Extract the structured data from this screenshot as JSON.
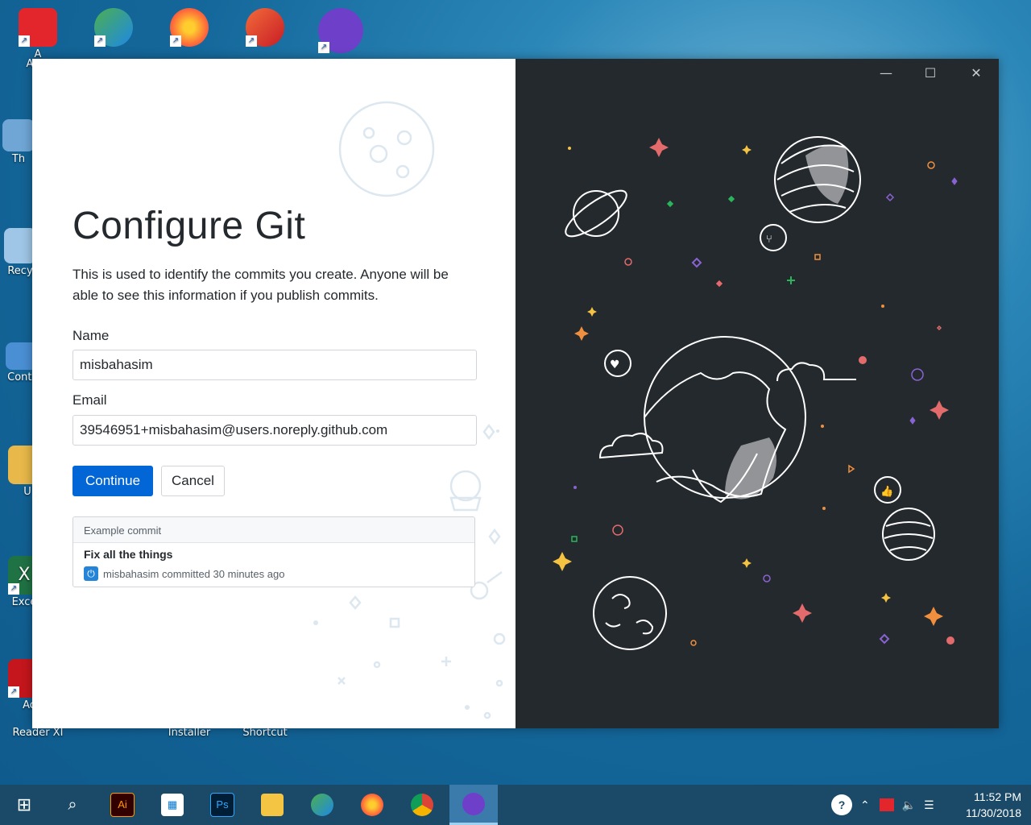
{
  "desktop": {
    "icons": [
      {
        "label": "A",
        "color": "#e3262c",
        "glyph": "A"
      },
      {
        "label": "",
        "color": "#2b8a3e",
        "glyph": "↓"
      },
      {
        "label": "",
        "color": "#ff7139",
        "glyph": "◉"
      },
      {
        "label": "",
        "color": "#d9352b",
        "glyph": "C"
      },
      {
        "label": "",
        "color": "#6e40c9",
        "glyph": "◐"
      },
      {
        "label": "Th",
        "color": "#6fa6d6",
        "glyph": ""
      },
      {
        "label": "Recy",
        "color": "#6fa6d6",
        "glyph": ""
      },
      {
        "label": "Contr",
        "color": "#4a8fd4",
        "glyph": ""
      },
      {
        "label": "U",
        "color": "#e8b84a",
        "glyph": ""
      },
      {
        "label": "Exce",
        "color": "#1f7244",
        "glyph": "X"
      },
      {
        "label": "Ac",
        "color": "#c4161c",
        "glyph": ""
      }
    ],
    "bottom_labels": [
      "Reader XI",
      "Installer",
      "Shortcut"
    ]
  },
  "window": {
    "controls": {
      "minimize": "—",
      "maximize": "☐",
      "close": "✕"
    },
    "title": "Configure Git",
    "description": "This is used to identify the commits you create. Anyone will be able to see this information if you publish commits.",
    "name_label": "Name",
    "name_value": "misbahasim",
    "email_label": "Email",
    "email_value": "39546951+misbahasim@users.noreply.github.com",
    "continue_label": "Continue",
    "cancel_label": "Cancel",
    "example_commit": {
      "header": "Example commit",
      "title": "Fix all the things",
      "meta": "misbahasim committed 30 minutes ago"
    }
  },
  "taskbar": {
    "apps": [
      {
        "name": "start",
        "glyph": "⊞",
        "color": "transparent"
      },
      {
        "name": "search",
        "glyph": "⌕",
        "color": "transparent"
      },
      {
        "name": "illustrator",
        "glyph": "Ai",
        "color": "#330000"
      },
      {
        "name": "store",
        "glyph": "🛍",
        "color": "transparent"
      },
      {
        "name": "photoshop",
        "glyph": "Ps",
        "color": "#001e36"
      },
      {
        "name": "explorer",
        "glyph": "📁",
        "color": "transparent"
      },
      {
        "name": "idm",
        "glyph": "↓",
        "color": "#2b8a3e"
      },
      {
        "name": "firefox",
        "glyph": "◉",
        "color": "#ff7139"
      },
      {
        "name": "chrome",
        "glyph": "◎",
        "color": "#db4437"
      },
      {
        "name": "github-desktop",
        "glyph": "◐",
        "color": "#6e40c9"
      }
    ],
    "time": "11:52 PM",
    "date": "11/30/2018"
  }
}
